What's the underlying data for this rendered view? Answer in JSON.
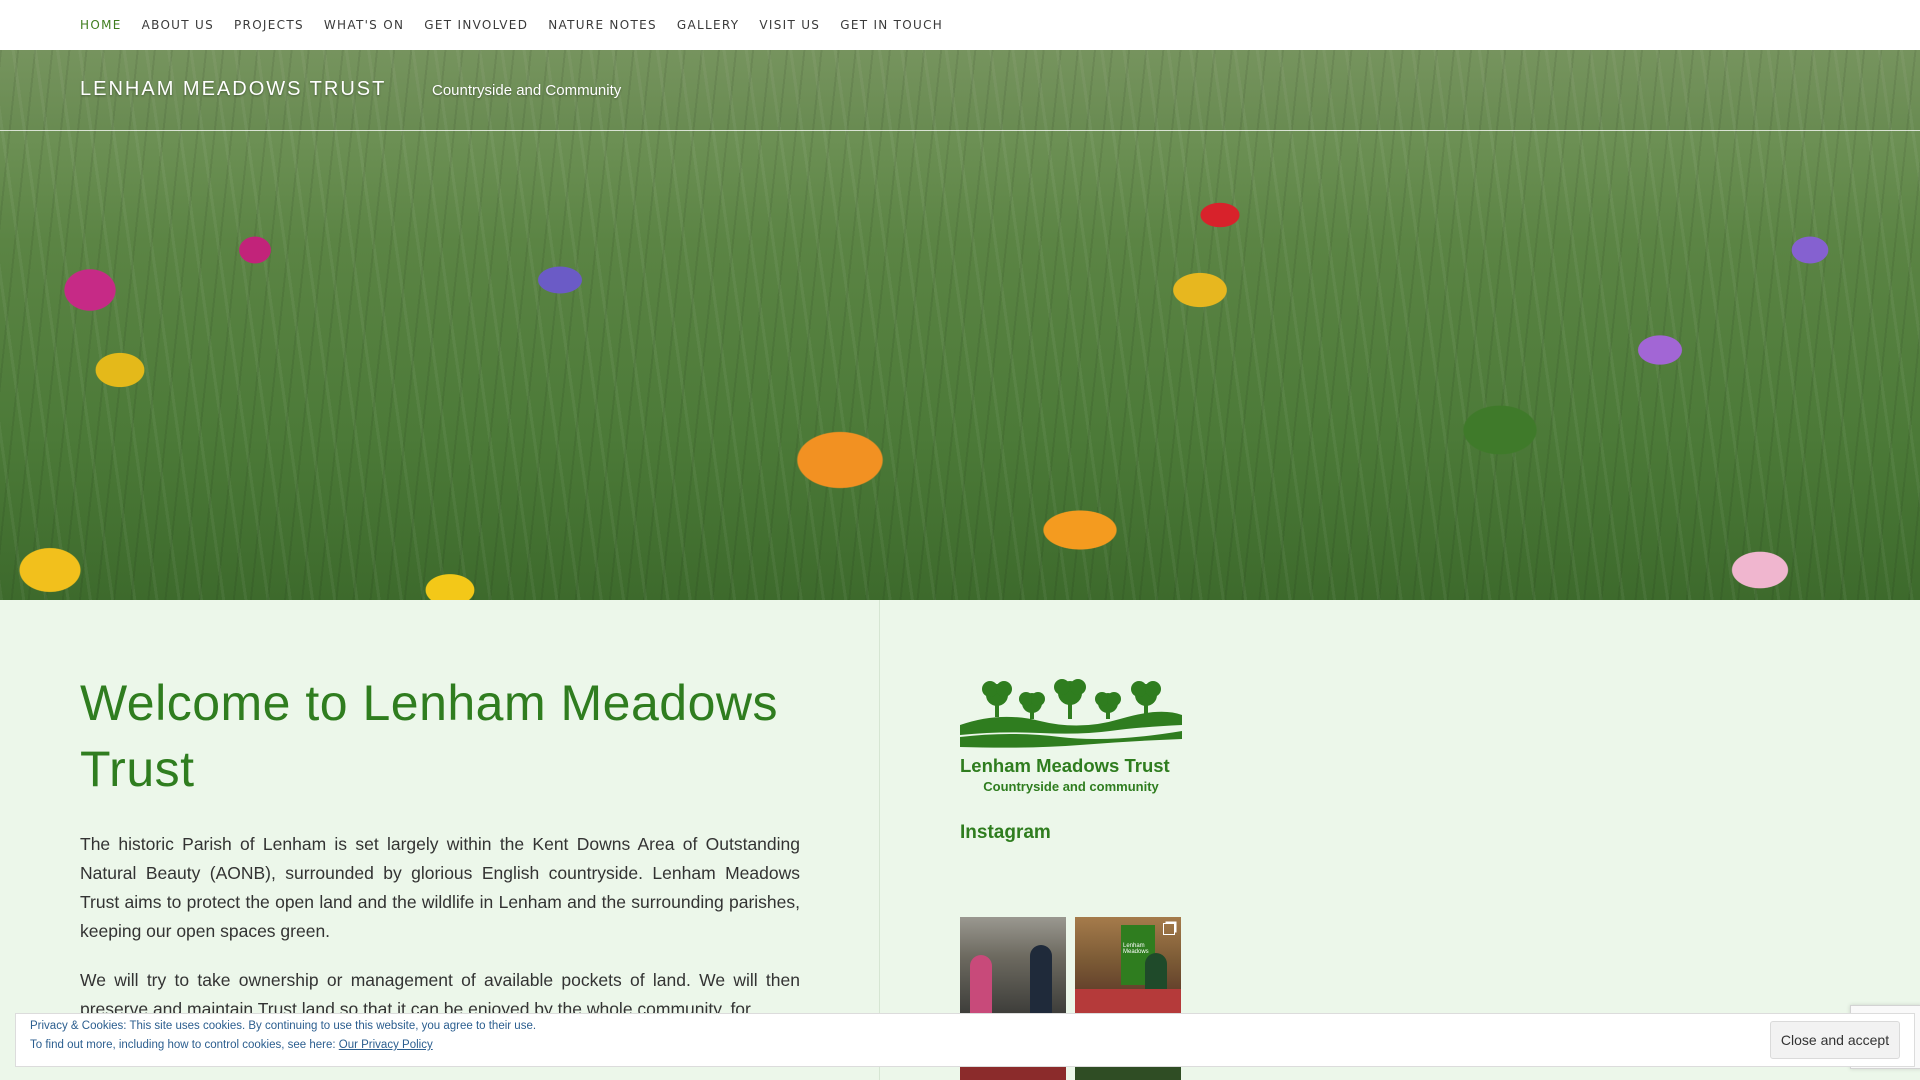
{
  "nav": {
    "items": [
      {
        "label": "HOME",
        "active": true
      },
      {
        "label": "ABOUT US"
      },
      {
        "label": "PROJECTS"
      },
      {
        "label": "WHAT'S ON"
      },
      {
        "label": "GET INVOLVED"
      },
      {
        "label": "NATURE NOTES"
      },
      {
        "label": "GALLERY"
      },
      {
        "label": "VISIT US"
      },
      {
        "label": "GET IN TOUCH"
      }
    ]
  },
  "header": {
    "site_title": "LENHAM MEADOWS TRUST",
    "tagline": "Countryside and Community"
  },
  "main": {
    "heading": "Welcome to Lenham Meadows Trust",
    "paragraph1": "The historic Parish of Lenham is set largely within the Kent Downs Area of Outstanding Natural Beauty (AONB), surrounded by glorious English countryside. Lenham Meadows Trust aims to protect the open land and the wildlife in Lenham and the surrounding parishes, keeping our open spaces green.",
    "paragraph2": "We will try to take ownership or management of available pockets of land.  We will then preserve and maintain Trust land so that it can be enjoyed by the whole community, for"
  },
  "sidebar": {
    "logo_name": "Lenham Meadows Trust",
    "logo_tagline": "Countryside and community",
    "instagram_heading": "Instagram",
    "logo_text": "Lenham Meadows"
  },
  "cookie": {
    "line1": "Privacy & Cookies: This site uses cookies. By continuing to use this website, you agree to their use.",
    "line2_prefix": "To find out more, including how to control cookies, see here: ",
    "policy_link": "Our Privacy Policy",
    "button": "Close and accept"
  },
  "colors": {
    "brand_green": "#2f7d1f",
    "nav_active": "#3f7d1e",
    "page_bg": "#ecf7ea"
  }
}
